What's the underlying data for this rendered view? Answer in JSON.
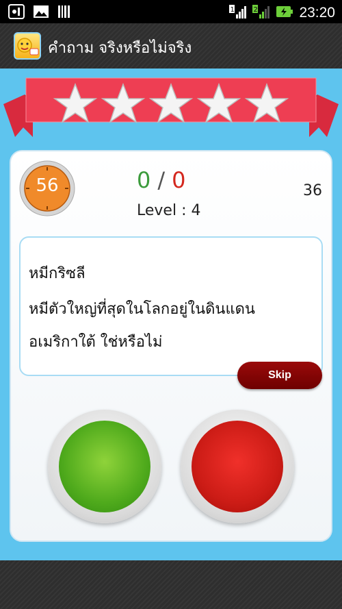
{
  "status_bar": {
    "time": "23:20",
    "sim1": "1",
    "sim2": "2"
  },
  "app": {
    "title": "คำถาม จริงหรือไม่จริง"
  },
  "game": {
    "timer": "56",
    "score_correct": "0",
    "score_separator": "/",
    "score_wrong": "0",
    "level_label": "Level : 4",
    "question_count": "36",
    "question_title": "หมีกริซลี",
    "question_body": "หมีตัวใหญ่ที่สุดในโลกอยู่ในดินแดนอเมริกาใต้ ใช่หรือไม่",
    "skip_label": "Skip",
    "stars_rating": 5
  },
  "colors": {
    "true_button": "#4faa1c",
    "false_button": "#cc1c16",
    "ribbon": "#ee3e53",
    "background": "#5ec4ee"
  }
}
